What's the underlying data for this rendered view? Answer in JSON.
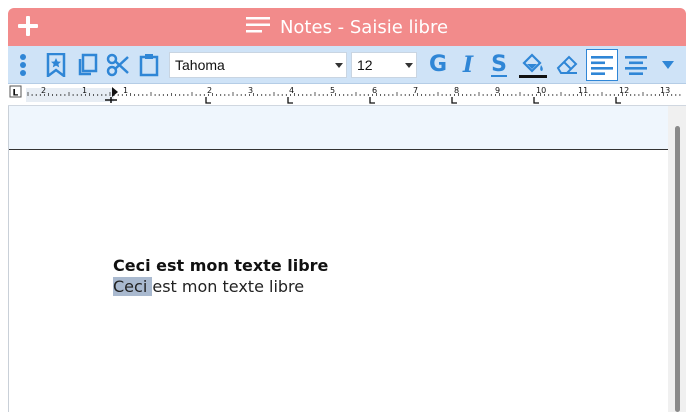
{
  "window": {
    "title": "Notes - Saisie libre",
    "accent_color": "#f28b8b",
    "toolbar_color": "#cfe3f7",
    "icon_color": "#2f86d6"
  },
  "toolbar": {
    "font_name": "Tahoma",
    "font_size": "12",
    "bold_label": "G",
    "italic_label": "I",
    "underline_label": "S"
  },
  "ruler": {
    "ticks": [
      "2",
      "1",
      "1",
      "2",
      "3",
      "4",
      "5",
      "6",
      "7",
      "8",
      "9",
      "10",
      "11",
      "12",
      "13"
    ],
    "tab_marker": "L"
  },
  "document": {
    "line1": "Ceci est mon texte libre",
    "line2_selected": "Ceci ",
    "line2_rest": "est mon texte libre"
  }
}
